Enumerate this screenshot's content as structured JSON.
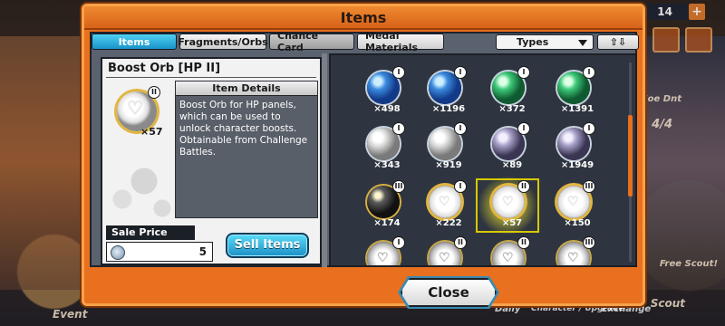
{
  "hud": {
    "gem_count": "14",
    "plus": "+",
    "right_labels": [
      "Noe Dnt",
      "4/4",
      "Free Scout!",
      "Scout"
    ],
    "left_labels": [
      "Event"
    ],
    "bottom_labels": [
      "Daily",
      "Character / Upgrade",
      "Exchange"
    ]
  },
  "dialog": {
    "title": "Items",
    "tabs": [
      {
        "label": "Items",
        "active": true
      },
      {
        "label": "Fragments/Orbs",
        "active": false
      },
      {
        "label": "Chance Card",
        "active": false
      },
      {
        "label": "Medal Materials",
        "active": false
      }
    ],
    "sort": {
      "selected": "Types",
      "direction_label": "⇧⇩"
    },
    "detail": {
      "name": "Boost Orb [HP II]",
      "tier": "II",
      "count": "×57",
      "section_title": "Item Details",
      "description": "Boost Orb for HP panels, which can be used to unlock character boosts. Obtainable from Challenge Battles.",
      "sale_price_label": "Sale Price",
      "sale_price": "5",
      "sell_button": "Sell Items"
    },
    "items": [
      {
        "kind": "blue",
        "tier": "I",
        "qty": "×498"
      },
      {
        "kind": "blue",
        "tier": "I",
        "qty": "×1196"
      },
      {
        "kind": "green",
        "tier": "I",
        "qty": "×372"
      },
      {
        "kind": "green",
        "tier": "I",
        "qty": "×1391"
      },
      {
        "kind": "white",
        "tier": "I",
        "qty": "×343"
      },
      {
        "kind": "white",
        "tier": "I",
        "qty": "×919"
      },
      {
        "kind": "purple",
        "tier": "I",
        "qty": "×89"
      },
      {
        "kind": "purple",
        "tier": "I",
        "qty": "×1949"
      },
      {
        "kind": "dark",
        "tier": "III",
        "qty": "×174"
      },
      {
        "kind": "boost",
        "tier": "I",
        "qty": "×222"
      },
      {
        "kind": "boost",
        "tier": "II",
        "qty": "×57",
        "selected": true
      },
      {
        "kind": "boost",
        "tier": "III",
        "qty": "×150"
      },
      {
        "kind": "spike",
        "tier": "I",
        "qty": ""
      },
      {
        "kind": "spike",
        "tier": "II",
        "qty": ""
      },
      {
        "kind": "spike",
        "tier": "II",
        "qty": ""
      },
      {
        "kind": "spike",
        "tier": "III",
        "qty": ""
      }
    ],
    "close_button": "Close"
  },
  "colors": {
    "frame": "#e8701e",
    "active_tab": "#1893c8",
    "sell_button": "#1c8fc6",
    "highlight": "#d8c800"
  }
}
